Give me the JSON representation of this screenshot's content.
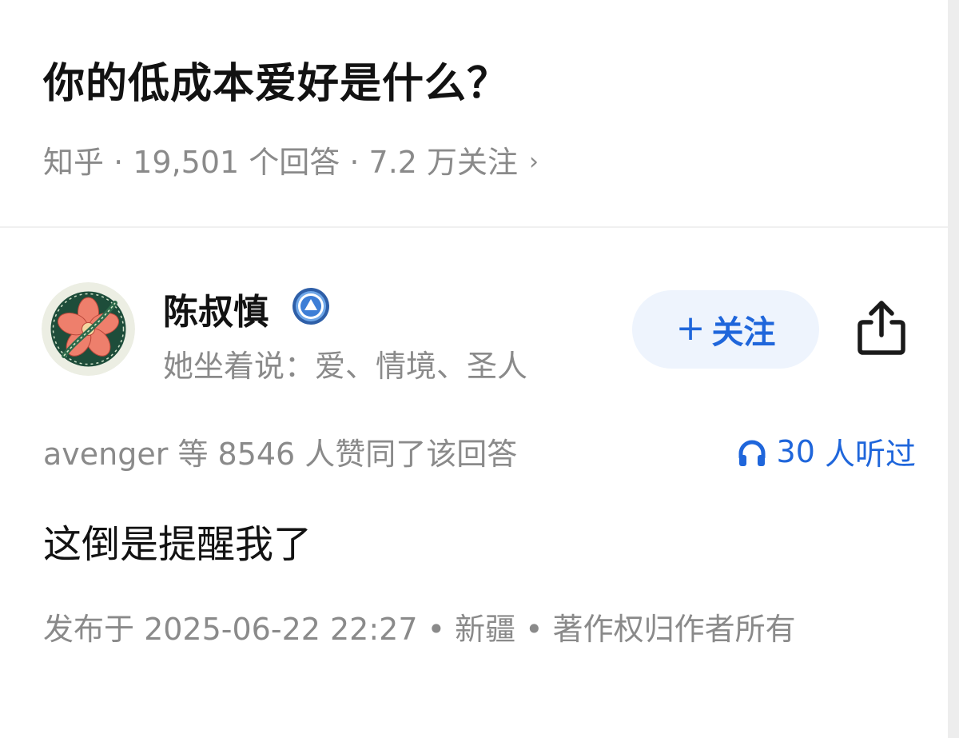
{
  "question": {
    "title": "你的低成本爱好是什么？",
    "meta": "知乎 · 19,501  个回答 · 7.2  万关注",
    "chevron": "›"
  },
  "author": {
    "name": "陈叔慎",
    "bio": "她坐着说：爱、情境、圣人",
    "avatar_icon": "flower-avatar-icon",
    "badge_icon": "verified-badge-icon"
  },
  "actions": {
    "follow_plus": "+",
    "follow_label": "关注",
    "share_icon": "share-icon"
  },
  "stats": {
    "votes_text": "avenger  等  8546  人赞同了该回答",
    "listen_count": "30",
    "listen_suffix": " 人听过",
    "listen_icon": "headphone-icon"
  },
  "answer": {
    "content": "这倒是提醒我了",
    "publish_info": "发布于  2025-06-22  22:27 • 新疆 • 著作权归作者所有"
  },
  "colors": {
    "accent_blue": "#1f66db",
    "follow_bg": "#eef4fd",
    "meta_gray": "#8a8a8a",
    "text_dark": "#121212"
  }
}
